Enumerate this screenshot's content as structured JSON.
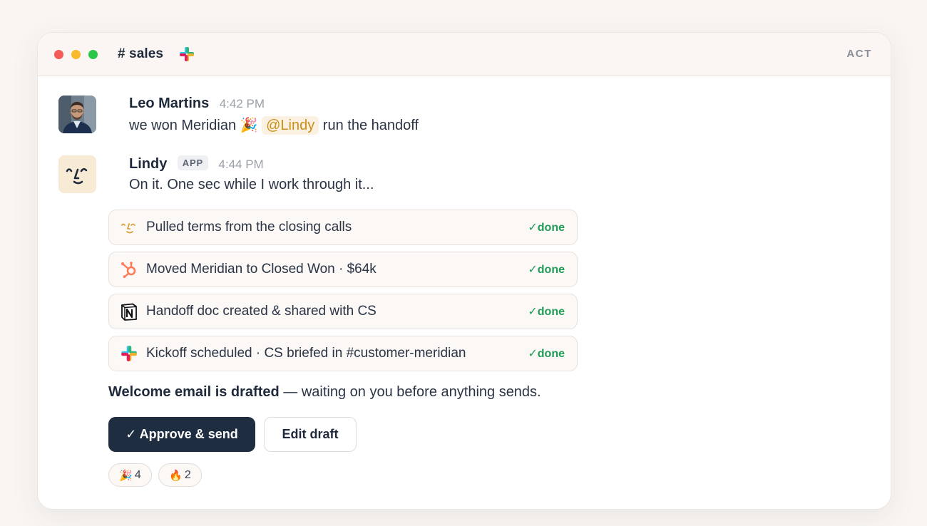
{
  "window": {
    "channel": "# sales",
    "right_label": "ACT",
    "traffic_lights": [
      "#f35d57",
      "#f8b92c",
      "#2cc648"
    ]
  },
  "messages": [
    {
      "author": "Leo Martins",
      "time": "4:42 PM",
      "text_before": "we won Meridian",
      "emoji": "🎉",
      "mention": "@Lindy",
      "text_after": "run the handoff"
    },
    {
      "author": "Lindy",
      "badge": "APP",
      "time": "4:44 PM",
      "text": "On it. One sec while I work through it..."
    }
  ],
  "tasks": [
    {
      "icon": "lindy-face-icon",
      "label": "Pulled terms from the closing calls",
      "status": "✓done"
    },
    {
      "icon": "hubspot-icon",
      "label": "Moved Meridian to Closed Won · $64k",
      "status": "✓done"
    },
    {
      "icon": "notion-icon",
      "label": "Handoff doc created & shared with CS",
      "status": "✓done"
    },
    {
      "icon": "slack-icon",
      "label": "Kickoff scheduled · CS briefed in #customer-meridian",
      "status": "✓done"
    }
  ],
  "note": {
    "bold": "Welcome email is drafted",
    "rest": " — waiting on you before anything sends."
  },
  "actions": {
    "approve": "✓ Approve & send",
    "edit": "Edit draft"
  },
  "reactions": [
    {
      "emoji": "🎉",
      "count": "4"
    },
    {
      "emoji": "🔥",
      "count": "2"
    }
  ],
  "colors": {
    "accent_done": "#1f9d58",
    "mention": "#c99017",
    "primary_button": "#1f2d40"
  }
}
